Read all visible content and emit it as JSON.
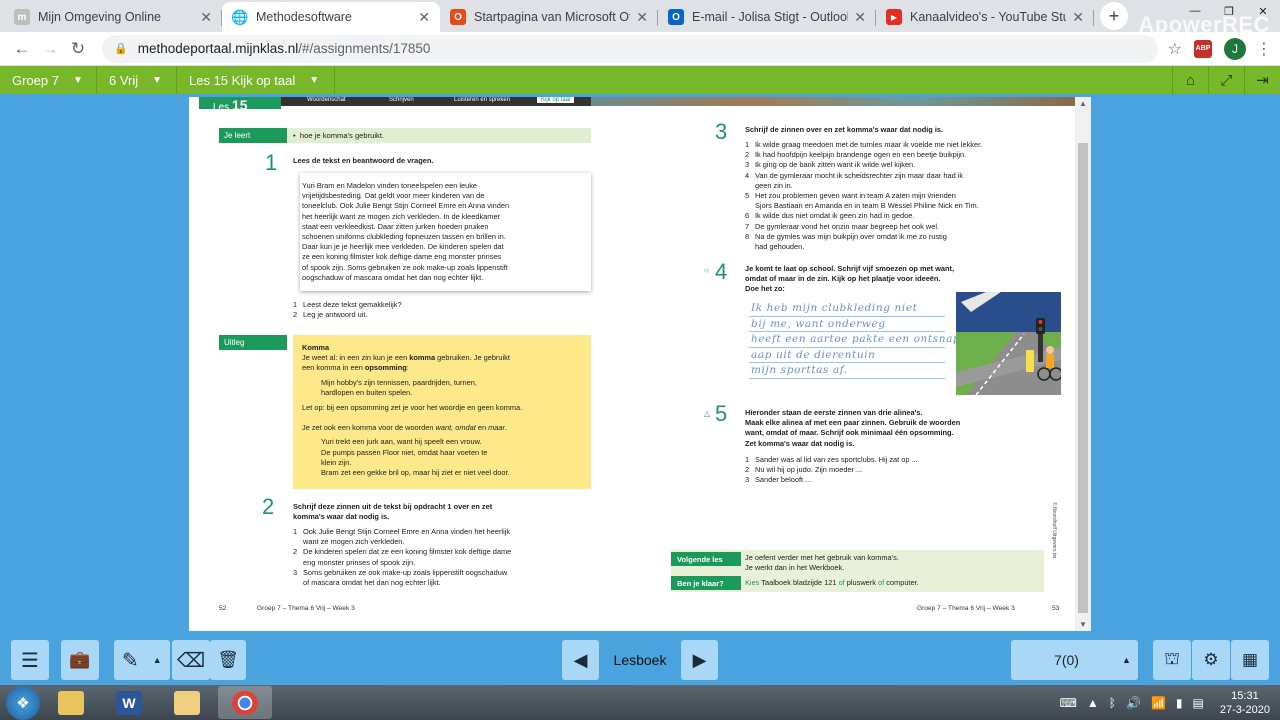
{
  "browser": {
    "tabs": [
      {
        "title": "Mijn Omgeving Online",
        "fav": "m",
        "color": "#bdbdbd",
        "active": false
      },
      {
        "title": "Methodesoftware",
        "fav": "globe",
        "color": "#5f6368",
        "active": true
      },
      {
        "title": "Startpagina van Microsoft Offic",
        "fav": "office",
        "color": "#e64a19",
        "active": false
      },
      {
        "title": "E-mail - Jolisa Stigt - Outlook",
        "fav": "outlook",
        "color": "#0a64c8",
        "active": false
      },
      {
        "title": "Kanaalvideo's - YouTube Studio",
        "fav": "yt",
        "color": "#e52d27",
        "active": false
      }
    ],
    "recorder_watermark": "ApowerREC",
    "url_host": "methodeportaal.mijnklas.nl",
    "url_path": "/#/assignments/17850",
    "abp_label": "ABP",
    "avatar_letter": "J"
  },
  "appbar": {
    "crumbs": [
      "Groep 7",
      "6 Vrij",
      "Les 15 Kijk op taal"
    ]
  },
  "page": {
    "banner": {
      "les": "Les",
      "num": "15",
      "tabs": [
        "Woordenschat",
        "Schrijven",
        "Luisteren en spreken",
        "Kijk op taal"
      ]
    },
    "left": {
      "je_leert_label": "Je leert",
      "je_leert_text": "hoe je komma's gebruikt.",
      "ex1_num": "1",
      "ex1_instr": "Lees de tekst en beantwoord de vragen.",
      "story": [
        "Yuri Bram en Madelon vinden toneelspelen een leuke",
        "vrijetijdsbesteding. Dat geldt voor meer kinderen van de",
        "toneelclub. Ook Julie Bengt Stijn Corneel Emre en Anna vinden",
        "het heerlijk want ze mogen zich verkleden. In de kleedkamer",
        "staat een verkleedkist. Daar zitten jurken hoeden pruiken",
        "schoenen uniforms clubkleding fopneuzen tassen en brillen in.",
        "Daar kun je je heerlijk mee verkleden. De kinderen spelen dat",
        "ze een koning filmster kok deftige dame eng monster prinses",
        "of spook zijn. Soms gebruiken ze ook make-up zoals lippenstift",
        "oogschaduw of mascara omdat het dan nog echter lijkt."
      ],
      "ex1_questions": [
        "Leest deze tekst gemakkelijk?",
        "Leg je antwoord uit."
      ],
      "uitleg_label": "Uitleg",
      "uitleg_title": "Komma",
      "uitleg_p1a": "Je weet al: in een zin kun je een ",
      "uitleg_p1b": "komma",
      "uitleg_p1c": " gebruiken. Je gebruikt",
      "uitleg_p1d": "een komma in een ",
      "uitleg_p1e": "opsomming",
      "uitleg_p1f": ":",
      "uitleg_ex1": [
        "Mijn hobby's zijn tennissen, paardrijden, turnen,",
        "hardlopen en buiten spelen."
      ],
      "uitleg_p2": "Let op: bij een opsomming zet je voor het woordje en geen komma.",
      "uitleg_p3a": "Je zet ook een komma voor de woorden ",
      "uitleg_p3b": "want, omdat",
      "uitleg_p3c": " en ",
      "uitleg_p3d": "maar",
      "uitleg_p3e": ".",
      "uitleg_ex2": [
        "Yuri trekt een jurk aan, want hij speelt een vrouw.",
        "De pumps passen Floor niet, omdat haar voeten te",
        "klein zijn.",
        "Bram zet een gekke bril op, maar hij ziet er niet veel door."
      ],
      "ex2_num": "2",
      "ex2_instr": [
        "Schrijf deze zinnen uit de tekst bij opdracht 1 over en zet",
        "komma's waar dat nodig is."
      ],
      "ex2_items": [
        [
          "Ook Julie Bengt Stijn Corneel Emre en Anna vinden het heerlijk",
          "want ze mogen zich verkleden."
        ],
        [
          "De kinderen spelen dat ze een koning filmster kok deftige dame",
          "eng monster prinses of spook zijn."
        ],
        [
          "Soms gebruiken ze ook make-up zoals lippenstift oogschaduw",
          "of mascara omdat het dan nog echter lijkt."
        ]
      ],
      "footer_page": "52",
      "footer_text": "Groep 7 – Thema 6 Vrij – Week 3"
    },
    "right": {
      "ex3_num": "3",
      "ex3_instr": "Schrijf de zinnen over en zet komma's waar dat nodig is.",
      "ex3_items": [
        [
          "Ik wilde graag meedoen met de turnles maar ik voelde me niet lekker."
        ],
        [
          "Ik had hoofdpijn keelpijn brandenge ogen en een beetje buikpijn."
        ],
        [
          "Ik ging op de bank zitten want ik wilde wel kijken."
        ],
        [
          "Van de gymleraar mocht ik scheidsrechter zijn maar daar had ik",
          "geen zin in."
        ],
        [
          "Het zou problemen geven want in team A zaten mijn vrienden",
          "Sjors Bastiaan en Amanda en in team B Wessel Philine Nick en Tim."
        ],
        [
          "Ik wilde dus niet omdat ik geen zin had in gedoe."
        ],
        [
          "De gymleraar vond het onzin maar begreep het ook wel."
        ],
        [
          "Na de gymles was mijn buikpijn over omdat ik me zo rustig",
          "had gehouden."
        ]
      ],
      "ex4_marker": "○",
      "ex4_num": "4",
      "ex4_instr": [
        "Je komt te laat op school. Schrijf vijf smoezen op met want,",
        "omdat of maar in de zin. Kijk op het plaatje voor ideeën.",
        "Doe het zo:"
      ],
      "handwriting": [
        "Ik heb mijn clubkleding niet",
        "bij me, want onderweg",
        "heeft een aartoe pakte een ontsnapte",
        "aap uit de dierentuin",
        "mijn sporttas af."
      ],
      "ex5_marker": "△",
      "ex5_num": "5",
      "ex5_instr": [
        "Hieronder staan de eerste zinnen van drie alinea's.",
        "Maak elke alinea af met een paar zinnen. Gebruik de woorden",
        "want, omdat of maar. Schrijf ook minimaal één opsomming.",
        "Zet komma's waar dat nodig is."
      ],
      "ex5_items": [
        "Sander was al lid van zes sportclubs. Hij zat op ...",
        "Nu wil hij op judo. Zijn moeder ...",
        "Sander belooft ..."
      ],
      "volgende_label": "Volgende les",
      "volgende_text": [
        "Je oefent verder met het gebruik van komma's.",
        "Je werkt dan in het Werkboek."
      ],
      "klaar_label": "Ben je klaar?",
      "klaar_text_a": "Kies",
      "klaar_text_b": " Taalboek bladzijde 121 ",
      "klaar_text_c": "of",
      "klaar_text_d": " pluswerk ",
      "klaar_text_e": "of",
      "klaar_text_f": " computer.",
      "footer_text": "Groep 7 – Thema 6 Vrij – Week 3",
      "footer_page": "53",
      "copyright": "© Noordhoff Uitgevers bv"
    }
  },
  "toolbar": {
    "lesboek_label": "Lesboek",
    "counter_value": "7(0)"
  },
  "taskbar": {
    "word_letter": "W",
    "clock_time": "15:31",
    "clock_date": "27-3-2020"
  }
}
